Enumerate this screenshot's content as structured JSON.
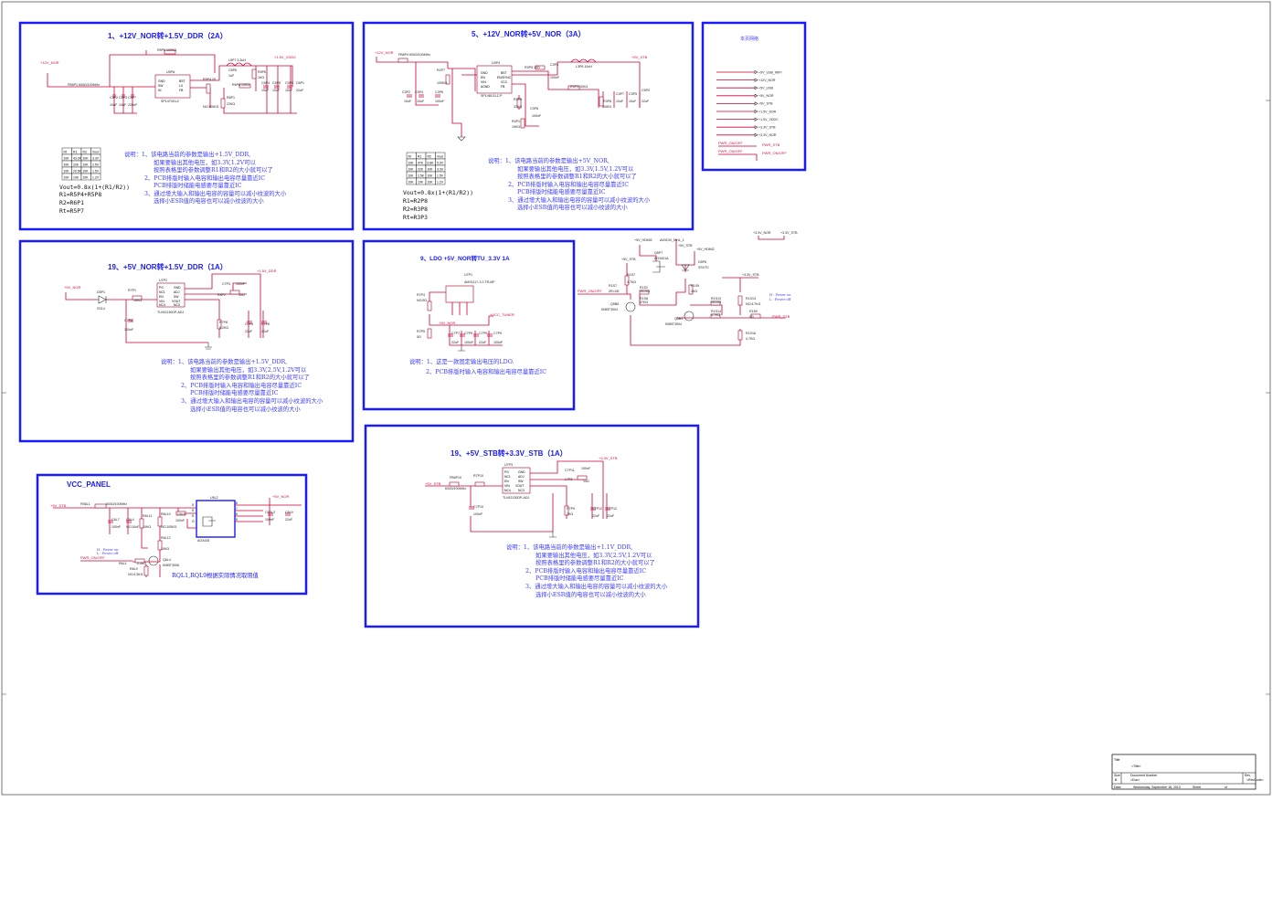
{
  "blocks": {
    "b1": {
      "title": "1、+12V_NOR转+1.5V_DDR（2A）",
      "notes": [
        "说明：1、该电路当前的参数是输出+1.5V_DDR,",
        "如果要输出其他电压，如3.3V,1.2V可以",
        "按照表格里的参数调整R1和R2的大小就可以了",
        "2、PCB排版时输入电容和输出电容尽量靠近IC",
        "PCB排版时储能电感要尽量靠近IC",
        "3、通过增大输入和输出电容的容量可以减小纹波的大小",
        "选择小ESR值的电容也可以减小纹波的大小"
      ],
      "formulas": [
        "Vout=0.8x(1+(R1/R2))",
        "R1=R5P4+R5P8",
        "R2=R6P1",
        "Rt=R5P7"
      ],
      "nets": [
        "+12V_NOR",
        "+1.5V_VDDC",
        "R5P5",
        "100KΩ",
        "U5P8",
        "SP1470GLZ",
        "GND",
        "EN",
        "BST",
        "LX",
        "FB",
        "L5P7",
        "3.3uH",
        "C5P2",
        "C5P3",
        "C5P7",
        "10uF",
        "R5P4",
        "R5P8",
        "R6P1",
        "22KΩ",
        "C5P4",
        "C5P5",
        "C5P6",
        "C5P7",
        "C5P8",
        "FB5P1",
        "600Ω/100MHz",
        "10uF",
        "22uF"
      ]
    },
    "b5": {
      "title": "5、+12V_NOR转+5V_NOR（3A）",
      "notes": [
        "说明：1、该电路当前的参数是输出+5V_NOR,",
        "如果要输出其他电压，如3.3V,1.5V,1.2V可以",
        "按照表格里的参数调整R1和R2的大小就可以了",
        "2、PCB排版时输入电容和输出电容尽量靠近IC",
        "PCB排版时储能电感要尽量靠近IC",
        "3、通过增大输入和输出电容的容量可以减小纹波的大小",
        "选择小ESR值的电容也可以减小纹波的大小"
      ],
      "formulas": [
        "Vout=0.8x(1+(R1/R2))",
        "R1=R2P8",
        "R2=R3P8",
        "Rt=R3P3"
      ],
      "nets": [
        "+12V_NOR",
        "FB6P4",
        "600Ω/100MHz",
        "+5V_STB",
        "U3P4",
        "SP1481GLZ",
        "EN",
        "GND",
        "BST",
        "LX",
        "FB",
        "L3P8",
        "10uH",
        "R3P4",
        "10Ω",
        "R3P3",
        "10KΩ",
        "C3P3",
        "C3P4",
        "C3P5",
        "C3P6",
        "C3P7",
        "C3P8",
        "22uF",
        "100nF",
        "10uF",
        "R3P2",
        "47KΩ"
      ]
    },
    "bnet": {
      "title": "本页网络",
      "nets": [
        "+5V_USB_WIFI",
        "+12V_NOR",
        "+5V_USB",
        "+5V_NOR",
        "+5V_STB",
        "+1.5V_DDR",
        "+1.5V_VDDC",
        "+3.3V_STB",
        "+3.3V_NOR",
        "PWR_ON/OFF"
      ],
      "pins": [
        "PWR_STB",
        "PWR_ON/OFF"
      ]
    },
    "b19a": {
      "title": "19、+5V_NOR转+1.5V_DDR（1A）",
      "notes": [
        "说明：1、该电路当前的参数是输出+1.5V_DDR,",
        "如果要输出其他电压，如3.3V,2.5V,1.2V可以",
        "按照表格里的参数调整R1和R2的大小就可以了",
        "2、PCB排版时输入电容和输出电容尽量靠近IC",
        "PCB排版时储能电感要尽量靠近IC",
        "3、通过增大输入和输出电容的容量可以减小纹波的大小",
        "选择小ESR值的电容也可以减小纹波的大小"
      ],
      "nets": [
        "+5V_NOR",
        "D5P1",
        "SS14",
        "R7P1",
        "10KΩ",
        "U7P2",
        "TLV62130DP-ADJ",
        "+1.5V_DDR",
        "C7P3",
        "C7P4",
        "C7P5",
        "C7P6",
        "L7P2",
        "10nF",
        "22uF",
        "100nF",
        "R7P8",
        "8.2KΩ"
      ]
    },
    "b9": {
      "title": "9、LDO +5V_NOR转TU_3.3V 1A",
      "notes": [
        "说明：1、这是一款固定输出电压的LDO.",
        "2、PCB排版时输入电容和输出电容尽量靠近IC"
      ],
      "nets": [
        "U7P1",
        "AMS1117-3.3 TR-MF",
        "R7P4",
        "NC/0Ω",
        "R7P5",
        "0Ω",
        "+5V_NOR",
        "+VCC_TUNER",
        "C7P7",
        "C7P8",
        "C7P9",
        "22uF",
        "100nF"
      ]
    },
    "bsw": {
      "nets": [
        "+5V_HDMI2",
        "AVDDIV_MHL_1",
        "+5V_STB",
        "+5V_HDMI2",
        "+3.3V_NOR",
        "+3.3V_STB",
        "Q5P7",
        "AO3401A",
        "D5P8",
        "SSVTC",
        "R1S7",
        "4.7KΩ",
        "R1S2",
        "NC/0Ω",
        "R1S8",
        "47KΩ",
        "R1S9",
        "1KΩ",
        "Q5B3",
        "KMBT3904",
        "Q5B6",
        "KMBT3904",
        "R1S13",
        "NC/4.7KΩ",
        "R1S14",
        "4.7KΩ",
        "R1S15",
        "NC/0Ω",
        "R1S16",
        "4.7KΩ",
        "R159",
        "0Ω",
        "PWR_ON/OFF",
        "PWR_STB"
      ],
      "annot": [
        "H : Power on",
        "L : Power off"
      ]
    },
    "b19b": {
      "title": "19、+5V_STB转+3.3V_STB（1A）",
      "notes": [
        "说明：1、该电路当前的参数是输出+1.1V_DDR,",
        "如果要输出其他电压，如3.3V,2.5V,1.2V可以",
        "按照表格里的参数调整R1和R2的大小就可以了",
        "2、PCB排版时输入电容和输出电容尽量靠近IC",
        "PCB排版时储能电感要尽量靠近IC",
        "3、通过增大输入和输出电容的容量可以减小纹波的大小",
        "选择小ESR值的电容也可以减小纹波的大小"
      ],
      "nets": [
        "+5V_STB",
        "FB6P10",
        "600Ω/100MHz",
        "R7P10",
        "U7P3",
        "TLV62130DP-ADJ",
        "+3.3V_STB",
        "C7P11",
        "C7P12",
        "C7P10",
        "L7P3",
        "R7P9",
        "100nF",
        "22uF"
      ]
    },
    "bvcc": {
      "title": "VCC_PANEL",
      "footnote": "RQL1,RQL9根据实际情况取阻值",
      "nets": [
        "+5V_STB",
        "FB6L1",
        "600Ω/100MHz",
        "U6L2",
        "AO4435",
        "+5V_NOR",
        "C6L1",
        "C6L2",
        "C6L4",
        "C6L6",
        "C6L7",
        "R6L11",
        "R6L12",
        "R6L13",
        "R6L8",
        "R6L9",
        "Q6L4",
        "KMBT3904",
        "PWR_ON/OFF",
        "100nF",
        "NC/10uF",
        "10KΩ",
        "47KΩ",
        "NC/100KΩ",
        "2.2KΩ",
        "1KΩ"
      ],
      "annot": [
        "H : Power on",
        "L : Power off"
      ]
    }
  },
  "title_block": {
    "title_label": "Title",
    "title_value": "<Title>",
    "size_label": "Size",
    "size_value": "B",
    "docnum_label": "Document Number",
    "docnum_value": "<Doc>",
    "rev_label": "Rev",
    "rev_value": "<RevCode>",
    "date_label": "Date:",
    "date_value": "Wednesday, September 18, 2013",
    "sheet_label": "Sheet",
    "sheet_of": "of"
  },
  "tables": {
    "b1": [
      [
        "Rt",
        "R1",
        "R2",
        "Vout"
      ],
      [
        "10K",
        "43.2K",
        "10K",
        "3.3V"
      ],
      [
        "10K",
        "22K",
        "10K",
        "2.5V"
      ],
      [
        "10K",
        "20.5K",
        "10K",
        "1.5V"
      ],
      [
        "10K",
        "10K",
        "10K",
        "1.2V"
      ]
    ],
    "b5": [
      [
        "Rt",
        "R1",
        "R2",
        "Vout"
      ],
      [
        "10K",
        "47K",
        "6.8K",
        "5.0V"
      ],
      [
        "10K",
        "22K",
        "10K",
        "3.3V"
      ],
      [
        "10K",
        "2.5K",
        "10K",
        "1.5V"
      ],
      [
        "10K",
        "10K",
        "10K",
        "1.2V"
      ]
    ]
  },
  "colors": {
    "frame": "#1a1aff",
    "wire": "#cc0033",
    "notes": "#3a3aff",
    "power": "#cc1144"
  }
}
